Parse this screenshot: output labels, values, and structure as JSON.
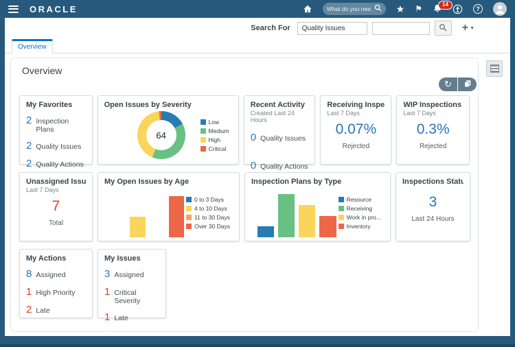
{
  "colors": {
    "header_navy": "#26597c",
    "tab_blue": "#0572ce",
    "accent_blue": "#2b74b8",
    "alert_red": "#e03c2d"
  },
  "header": {
    "brand": "ORACLE",
    "search_placeholder": "What do you nee",
    "notification_count": "14"
  },
  "toolbar": {
    "search_for_label": "Search For",
    "search_category": "Quality Issues",
    "search_value": ""
  },
  "tabs": [
    {
      "label": "Overview"
    }
  ],
  "page": {
    "title": "Overview"
  },
  "cards": {
    "my_favorites": {
      "title": "My Favorites",
      "items": [
        {
          "value": "2",
          "label": "Inspection Plans",
          "color": "#2b74b8"
        },
        {
          "value": "2",
          "label": "Quality Issues",
          "color": "#2b74b8"
        },
        {
          "value": "2",
          "label": "Quality Actions",
          "color": "#2b74b8"
        }
      ]
    },
    "recent_activity": {
      "title": "Recent Activity",
      "subtitle": "Created Last 24 Hours",
      "items": [
        {
          "value": "0",
          "label": "Quality Issues",
          "color": "#2b74b8"
        },
        {
          "value": "0",
          "label": "Quality Actions",
          "color": "#2b74b8"
        }
      ]
    },
    "receiving_inspections": {
      "title": "Receiving Inspecti...",
      "subtitle": "Last 7 Days",
      "value": "0.07%",
      "value_color": "#2b74b8",
      "label": "Rejected"
    },
    "wip_inspections": {
      "title": "WIP Inspections",
      "subtitle": "Last 7 Days",
      "value": "0.3%",
      "value_color": "#2b74b8",
      "label": "Rejected"
    },
    "unassigned_issues": {
      "title": "Unassigned Issues",
      "subtitle": "Last 7 Days",
      "value": "7",
      "value_color": "#e03c2d",
      "label": "Total"
    },
    "inspections_status": {
      "title": "Inspections Status",
      "value": "3",
      "value_color": "#2b74b8",
      "label": "Last 24 Hours"
    },
    "my_actions": {
      "title": "My Actions",
      "items": [
        {
          "value": "8",
          "label": "Assigned",
          "color": "#2b74b8"
        },
        {
          "value": "1",
          "label": "High Priority",
          "color": "#e03c2d"
        },
        {
          "value": "2",
          "label": "Late",
          "color": "#e03c2d"
        }
      ]
    },
    "my_issues": {
      "title": "My Issues",
      "items": [
        {
          "value": "3",
          "label": "Assigned",
          "color": "#2b74b8"
        },
        {
          "value": "1",
          "label": "Critical Severity",
          "color": "#e03c2d"
        },
        {
          "value": "1",
          "label": "Late",
          "color": "#e03c2d"
        }
      ]
    }
  },
  "chart_data": [
    {
      "type": "donut",
      "title": "Open Issues by Severity",
      "center_total": 64,
      "series": [
        {
          "name": "Low",
          "value": 11,
          "color": "#267db3"
        },
        {
          "name": "Medium",
          "value": 25,
          "color": "#68c182"
        },
        {
          "name": "High",
          "value": 27,
          "color": "#fad55c"
        },
        {
          "name": "Critical",
          "value": 1,
          "color": "#ed6647"
        }
      ],
      "legend_position": "right"
    },
    {
      "type": "bar",
      "title": "My Open Issues by Age",
      "categories": [
        "0 to 3 Days",
        "4 to 10 Days",
        "11 to 30 Days",
        "Over 30 Days"
      ],
      "values": [
        0,
        1,
        0,
        2
      ],
      "colors": [
        "#267db3",
        "#fad55c",
        "#f7a35c",
        "#ed6647"
      ],
      "ylim": [
        0,
        2.4
      ],
      "legend_position": "right"
    },
    {
      "type": "bar",
      "title": "Inspection Plans by Type",
      "categories": [
        "Resource",
        "Receiving",
        "Work in pro...",
        "Inventory"
      ],
      "values": [
        1,
        4,
        3,
        2
      ],
      "colors": [
        "#267db3",
        "#68c182",
        "#fad55c",
        "#ed6647"
      ],
      "ylim": [
        0,
        4.6
      ],
      "legend_position": "right"
    }
  ]
}
